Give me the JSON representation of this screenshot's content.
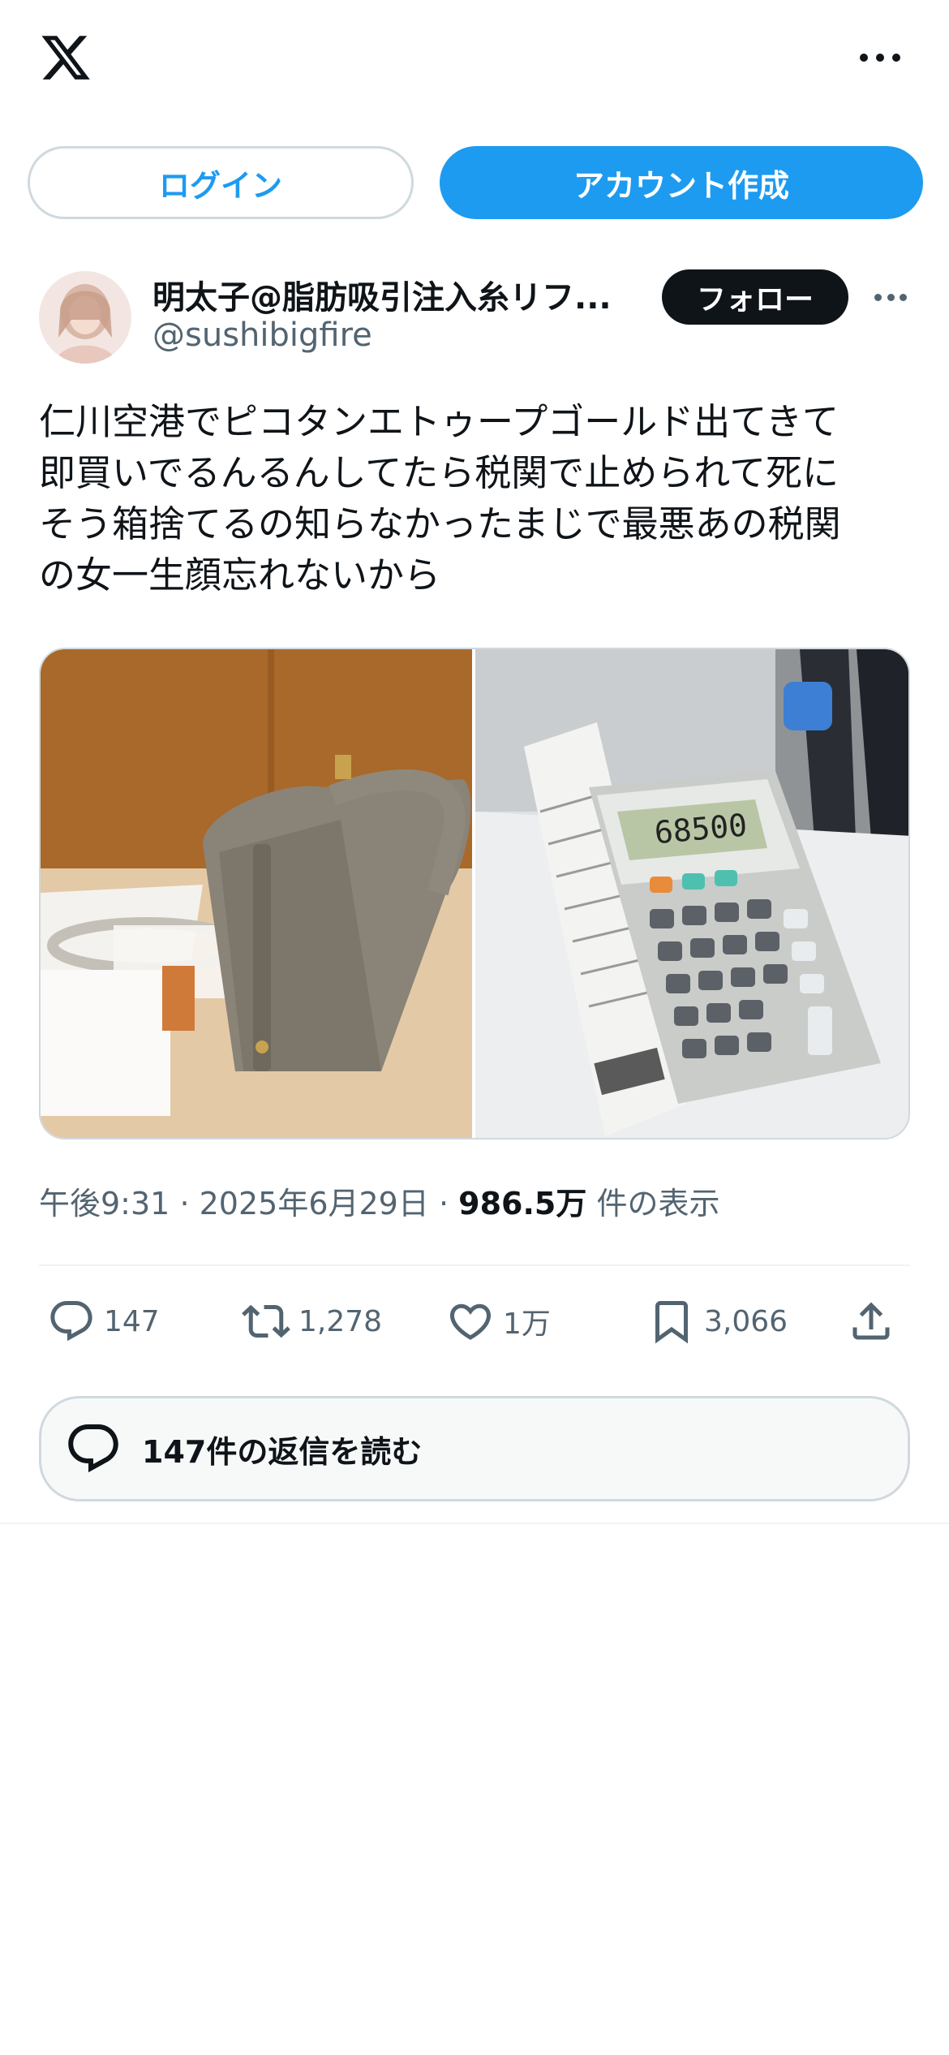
{
  "header": {
    "logo": "x-logo-icon",
    "more": "more-icon"
  },
  "auth": {
    "login_label": "ログイン",
    "create_label": "アカウント作成"
  },
  "tweet": {
    "author_name": "明太子@脂肪吸引注入糸リフ...",
    "author_handle": "@sushibigfire",
    "follow_label": "フォロー",
    "text": "仁川空港でピコタンエトゥープゴールド出てきて\n即買いでるんるんしてたら税関で止められて死に\nそう箱捨てるの知らなかったまじで最悪あの税関\nの女一生顔忘れないから",
    "calculator_display": "68500",
    "meta": {
      "time": "午後9:31",
      "separator": "·",
      "date": "2025年6月29日",
      "views_count": "986.5万",
      "views_label": "件の表示"
    },
    "stats": {
      "replies": "147",
      "reposts": "1,278",
      "likes": "1万",
      "bookmarks": "3,066"
    },
    "read_replies_label": "147件の返信を読む"
  },
  "colors": {
    "accent": "#1d9bf0",
    "text": "#0f1419",
    "muted": "#536471",
    "border": "#cfd9de"
  }
}
